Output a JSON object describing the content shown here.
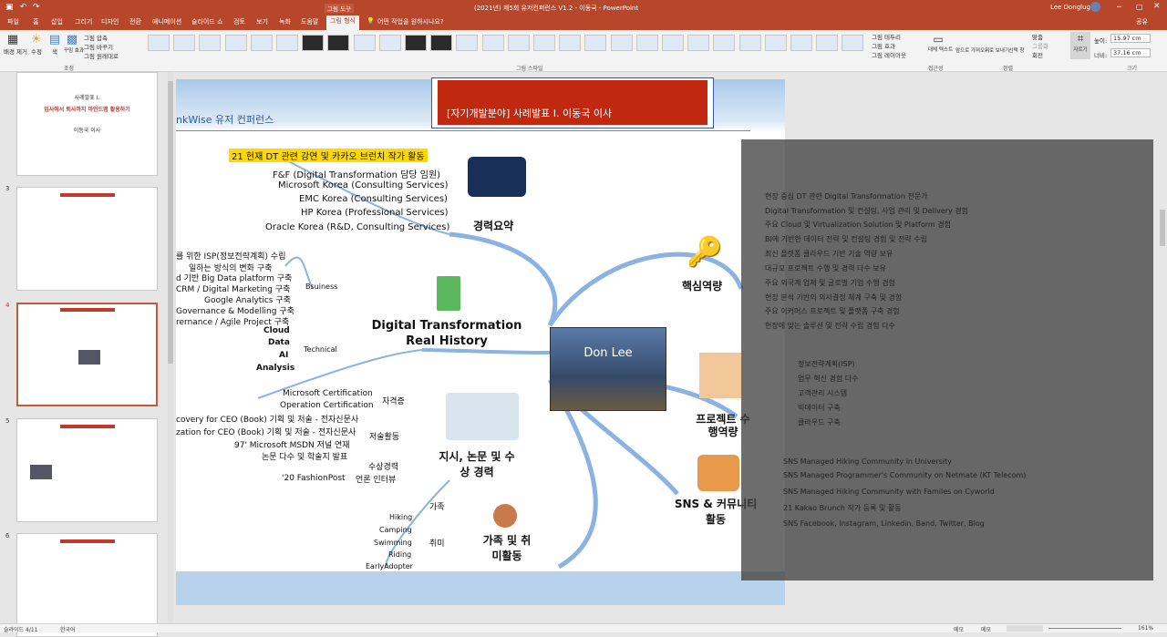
{
  "titlebar": {
    "context": "그림 도구",
    "title": "(2021년) 제5회 유저컨퍼런스 V1.2 - 이동국 - PowerPoint",
    "user": "Lee Donglug"
  },
  "tabs": [
    "파일",
    "홈",
    "삽입",
    "그리기",
    "디자인",
    "전환",
    "애니메이션",
    "슬라이드 쇼",
    "검토",
    "보기",
    "녹화",
    "도움말",
    "그림 형식"
  ],
  "tell_me": "어떤 작업을 원하시나요?",
  "share": "공유",
  "ribbon": {
    "remove_bg": "배경 제거",
    "corrections": "수정",
    "color": "색",
    "artistic": "꾸밈 효과",
    "compress": "그림 압축",
    "change": "그림 바꾸기",
    "reset": "그림 원래대로",
    "group_adjust": "조정",
    "group_styles": "그림 스타일",
    "border": "그림 테두리",
    "effects": "그림 효과",
    "layout": "그림 레이아웃",
    "alt_text": "대체 텍스트",
    "group_access": "접근성",
    "forward": "앞으로 가져오기",
    "backward": "뒤로 보내기",
    "selection": "선택 창",
    "align": "맞춤",
    "group_obj": "그룹화",
    "rotate": "회전",
    "group_arrange": "정렬",
    "crop": "자르기",
    "height": "15.97 cm",
    "width": "37.16 cm",
    "height_lbl": "높이:",
    "width_lbl": "너비:",
    "group_size": "크기"
  },
  "slides": {
    "nums": [
      "3",
      "4",
      "5",
      "6"
    ],
    "s2_title": "사례발표 I.",
    "s2_sub": "입사에서 퇴사까지 마인드맵 활용하기",
    "s2_name": "이동국 이사"
  },
  "slide": {
    "header": "[자기개발분야]  사례발표 I.  이동국 이사",
    "conference": "nkWise 유저 컨퍼런스",
    "highlight": "21 현재 DT 관련 강연 및 카카오 브런치 작가 활동",
    "career": [
      "F&F (Digital Transformation 담당 임원)",
      "Microsoft Korea (Consulting Services)",
      "EMC Korea (Consulting Services)",
      "HP Korea (Professional Services)",
      "Oracle Korea (R&D, Consulting Services)"
    ],
    "career_label": "경력요약",
    "business": [
      "를 위한 ISP(정보전략계획) 수립",
      "일하는 방식의 변화 구축",
      "d 기반 Big Data platform 구축",
      "CRM / Digital Marketing 구축",
      "Google Analytics 구축",
      "Governance & Modelling 구축",
      "rernance / Agile Project 구축"
    ],
    "bsuiness": "Bsuiness",
    "tech": [
      "Cloud",
      "Data",
      "AI",
      "Analysis"
    ],
    "technical": "Technical",
    "center": "Digital Transformation Real History",
    "photo": "Don Lee",
    "core": "핵심역량",
    "project": "프로젝트 수행역량",
    "sns": "SNS & 커뮤니티 활동",
    "certs": [
      "Microsoft Certification",
      "Operation Certification"
    ],
    "cert_label": "자격증",
    "writing": [
      "covery for CEO (Book) 기획 및 저술 - 전자신문사",
      "zation for CEO (Book) 기획 및 저술 - 전자신문사",
      "97' Microsoft MSDN 저널 연재",
      "논문 다수 및 학술지 발표"
    ],
    "writing_label": "저술활동",
    "award": "수상경력",
    "fashion": "'20 FashionPost",
    "interview": "언론 인터뷰",
    "paper_label": "지시, 논문 및 수상 경력",
    "family": "가족",
    "hobbies": [
      "Hiking",
      "Camping",
      "Swimming",
      "Riding",
      "EarlyAdopter"
    ],
    "hobby": "취미",
    "family_label": "가족 및 취미활동",
    "dim_core": [
      "현장 중심 DT 관련 Digital Transformation 전문가",
      "Digital Transformation 및 컨설팅, 사업 관리 및 Delivery 경험",
      "주요 Cloud 및 Virtualization Solution 및 Platform 경험",
      "BI에 기반한 데이터 전략 및 컨설팅 경험 및 전략 수립",
      "최신 플랫폼 클라우드 기반 기술 역량 보유",
      "대규모 프로젝트 수행 및 경력 다수 보유",
      "주요 외국계 업체 및 글로벌 기업 수행 경험",
      "현장 분석 기반의 의사결정 체계 구축 및 경험",
      "주요 이커머스 프로젝트 및 플랫폼 구축 경험",
      "현장에 맞는 솔루션 및 전략 수립 경험 다수"
    ],
    "dim_project": [
      "정보전략계획(ISP)",
      "업무 혁신 경험 다수",
      "고객관리 시스템",
      "빅데이터 구축",
      "클라우드 구축"
    ],
    "dim_sns": [
      "SNS Managed Hiking Community in University",
      "SNS Managed Programmer's Community on Netmate (KT Telecom)",
      "SNS Managed Hiking Community with Familes on Cyworld",
      "21 Kakao Brunch 작가 등록 및 활동",
      "SNS Facebook, Instagram, Linkedin, Band, Twitter, Blog"
    ]
  },
  "status": {
    "slide": "슬라이드 4/11",
    "lang": "한국어",
    "notes": "메모",
    "comments": "메모",
    "zoom": "161%"
  }
}
